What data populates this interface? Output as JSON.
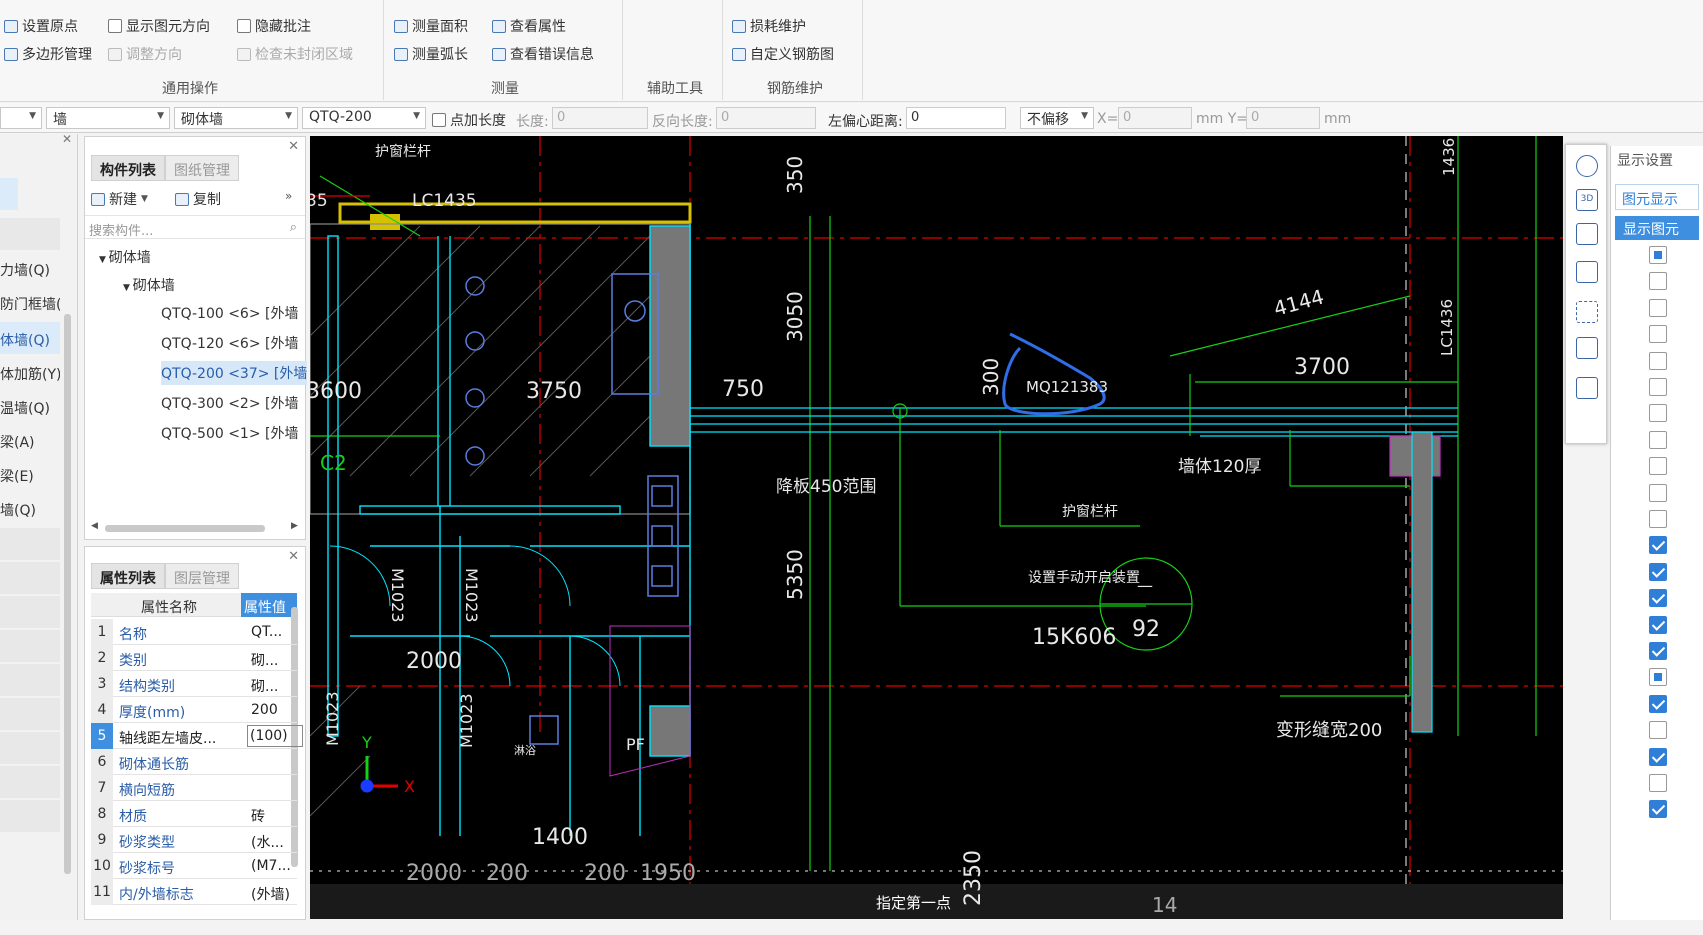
{
  "ribbon": {
    "general": {
      "set_origin": "设置原点",
      "show_direction": "显示图元方向",
      "hide_annotation": "隐藏批注",
      "polygon_manage": "多边形管理",
      "adjust_direction": "调整方向",
      "check_unclosed": "检查未封闭区域",
      "group_label": "通用操作"
    },
    "measure": {
      "measure_area": "测量面积",
      "view_attribute": "查看属性",
      "measure_arc": "测量弧长",
      "view_error": "查看错误信息",
      "group_label": "测量"
    },
    "aux": {
      "group_label": "辅助工具"
    },
    "rebar": {
      "loss_maintain": "损耗维护",
      "custom_rebar": "自定义钢筋图",
      "group_label": "钢筋维护"
    }
  },
  "toolbar2": {
    "sel_type": "墙",
    "sel_material": "砌体墙",
    "sel_component": "QTQ-200",
    "point_length": "点加长度",
    "length_label": "长度:",
    "length_value": "0",
    "reverse_length_label": "反向长度:",
    "reverse_length_value": "0",
    "left_offset_label": "左偏心距离:",
    "left_offset_value": "0",
    "offset_mode": "不偏移",
    "x_label": "X=",
    "x_value": "0",
    "mm_y": "mm Y=",
    "y_value": "0",
    "mm": "mm"
  },
  "left_sidebar": {
    "items": [
      "力墙(Q)",
      "防门框墙(",
      "体墙(Q)",
      "体加筋(Y)",
      "温墙(Q)",
      "梁(A)",
      "梁(E)",
      "墙(Q)"
    ]
  },
  "component_panel": {
    "tab_active": "构件列表",
    "tab_inactive": "图纸管理",
    "new_btn": "新建",
    "copy_btn": "复制",
    "search_placeholder": "搜索构件...",
    "tree_root": "砌体墙",
    "tree_child": "砌体墙",
    "items": [
      "QTQ-100 <6> [外墙",
      "QTQ-120 <6> [外墙",
      "QTQ-200 <37> [外墙",
      "QTQ-300 <2> [外墙",
      "QTQ-500 <1> [外墙"
    ]
  },
  "property_panel": {
    "tab_active": "属性列表",
    "tab_inactive": "图层管理",
    "col_name": "属性名称",
    "col_value": "属性值",
    "rows": [
      {
        "n": "1",
        "name": "名称",
        "value": "QT..."
      },
      {
        "n": "2",
        "name": "类别",
        "value": "砌..."
      },
      {
        "n": "3",
        "name": "结构类别",
        "value": "砌..."
      },
      {
        "n": "4",
        "name": "厚度(mm)",
        "value": "200"
      },
      {
        "n": "5",
        "name": "轴线距左墙皮...",
        "value": "(100)"
      },
      {
        "n": "6",
        "name": "砌体通长筋",
        "value": ""
      },
      {
        "n": "7",
        "name": "横向短筋",
        "value": ""
      },
      {
        "n": "8",
        "name": "材质",
        "value": "砖"
      },
      {
        "n": "9",
        "name": "砂浆类型",
        "value": "(水..."
      },
      {
        "n": "10",
        "name": "砂浆标号",
        "value": "(M7..."
      },
      {
        "n": "11",
        "name": "内/外墙标志",
        "value": "(外墙)"
      }
    ]
  },
  "canvas": {
    "labels": {
      "guard_rail_top": "护窗栏杆",
      "lc1435": "LC1435",
      "d350": "350",
      "d3050": "3050",
      "d750": "750",
      "d3600": "3600",
      "d3750": "3750",
      "d300": "300",
      "mq": "MQ121383",
      "d4144": "4144",
      "d3700": "3700",
      "lc1436": "LC1436",
      "wall120": "墙体120厚",
      "slab450": "降板450范围",
      "guard_rail": "护窗栏杆",
      "manual_open": "设置手动开启装置",
      "k606": "15K606",
      "n92": "92",
      "dash": "—",
      "d5350": "5350",
      "m1023a": "M1023",
      "m1023b": "M1023",
      "m1023c": "M1023",
      "m1023d": "M1023",
      "d2000": "2000",
      "pf": "PF",
      "zhenjian": "淋浴",
      "d1400": "1400",
      "d2000b": "2000",
      "d200a": "200",
      "d200b": "200",
      "d1950": "1950",
      "d2350": "2350",
      "expansion": "变形缝宽200",
      "d14": "14",
      "top1436": "1436",
      "c2": "C2",
      "d35": "35",
      "prompt": "指定第一点",
      "axis_y": "Y",
      "axis_x": "X"
    }
  },
  "right_panel": {
    "title": "显示设置",
    "tab1": "图元显示",
    "col_header": "显示图元",
    "checks": [
      "part",
      "off",
      "off",
      "off",
      "off",
      "off",
      "off",
      "off",
      "off",
      "off",
      "off",
      "on",
      "on",
      "on",
      "on",
      "on",
      "part",
      "on",
      "off",
      "on",
      "off",
      "on"
    ]
  },
  "colors": {
    "ribbon_bg": "#f7f7f7",
    "canvas_bg": "#000000",
    "accent_blue": "#2f7fd8",
    "cad_cyan": "#00e5ff",
    "cad_green": "#16d016",
    "cad_red": "#e00000",
    "cad_yellow": "#d6c100",
    "annotation_blue": "#2f6ee8"
  }
}
